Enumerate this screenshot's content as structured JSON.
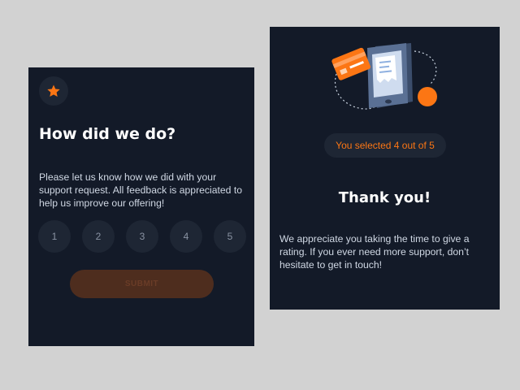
{
  "rating_card": {
    "title": "How did we do?",
    "description": "Please let us know how we did with your support request. All feedback is appreciated to help us improve our offering!",
    "rating_options": [
      "1",
      "2",
      "3",
      "4",
      "5"
    ],
    "submit_label": "SUBMIT",
    "icon": "star-icon"
  },
  "thank_you_card": {
    "selected_text": "You selected 4 out of 5",
    "title": "Thank you!",
    "description": "We appreciate you taking the time to give a rating. If you ever need more support, don’t hesitate to get in touch!",
    "illustration": "phone-payment-illustration"
  },
  "colors": {
    "page_background": "#d2d2d2",
    "card_background": "#131a28",
    "accent_orange": "#fc7614",
    "circle_background": "#1e2634",
    "title_text": "#ffffff",
    "body_text": "#d0d8e4",
    "submit_disabled": "#4e2d1e"
  }
}
